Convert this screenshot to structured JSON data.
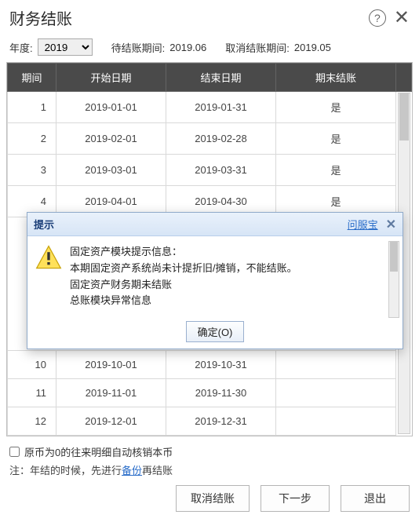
{
  "header": {
    "title": "财务结账"
  },
  "filter": {
    "year_label": "年度:",
    "year_value": "2019",
    "pending_label": "待结账期间:",
    "pending_value": "2019.06",
    "cancel_label": "取消结账期间:",
    "cancel_value": "2019.05"
  },
  "table": {
    "cols": {
      "period": "期间",
      "start": "开始日期",
      "end": "结束日期",
      "closed": "期末结账"
    },
    "width": {
      "period": "62px",
      "start": "140px",
      "end": "140px",
      "closed": ""
    },
    "rows": [
      {
        "period": "1",
        "start": "2019-01-01",
        "end": "2019-01-31",
        "closed": "是"
      },
      {
        "period": "2",
        "start": "2019-02-01",
        "end": "2019-02-28",
        "closed": "是"
      },
      {
        "period": "3",
        "start": "2019-03-01",
        "end": "2019-03-31",
        "closed": "是"
      },
      {
        "period": "4",
        "start": "2019-04-01",
        "end": "2019-04-30",
        "closed": "是"
      },
      {
        "period": "10",
        "start": "2019-10-01",
        "end": "2019-10-31",
        "closed": ""
      },
      {
        "period": "11",
        "start": "2019-11-01",
        "end": "2019-11-30",
        "closed": ""
      },
      {
        "period": "12",
        "start": "2019-12-01",
        "end": "2019-12-31",
        "closed": ""
      }
    ]
  },
  "footer": {
    "checkbox_label": "原币为0的往来明细自动核销本币",
    "note_prefix": "注：年结的时候，先进行",
    "note_link": "备份",
    "note_suffix": "再结账",
    "btn_cancel": "取消结账",
    "btn_next": "下一步",
    "btn_exit": "退出"
  },
  "modal": {
    "title": "提示",
    "ask_link": "问服宝",
    "lines": [
      "固定资产模块提示信息：",
      "本期固定资产系统尚未计提折旧/摊销，不能结账。",
      "固定资产财务期未结账",
      "总账模块异常信息"
    ],
    "ok_label": "确定(O)"
  }
}
